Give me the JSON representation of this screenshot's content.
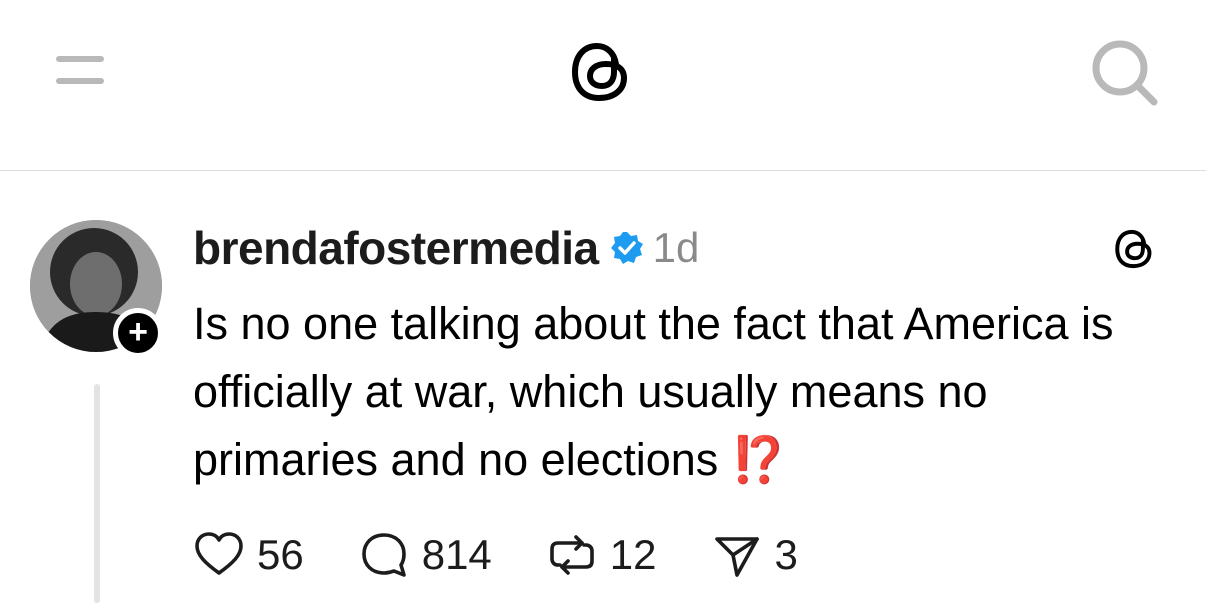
{
  "header": {
    "menu_icon": "hamburger-menu-icon",
    "logo_icon": "threads-logo-icon",
    "search_icon": "search-icon"
  },
  "post": {
    "username": "brendafostermedia",
    "verified_icon": "verified-badge-icon",
    "time": "1d",
    "platform_icon": "threads-logo-icon",
    "follow_icon": "plus-icon",
    "text": "Is no one talking about the fact that America is officially at war, which usually means no primaries and no elections",
    "emoji": "⁉️",
    "actions": {
      "likes": "56",
      "replies": "814",
      "reposts": "12",
      "shares": "3"
    }
  },
  "colors": {
    "verified_blue": "#1d9bf0",
    "muted_gray": "#8a8a8a",
    "divider": "#dcdcdc"
  }
}
